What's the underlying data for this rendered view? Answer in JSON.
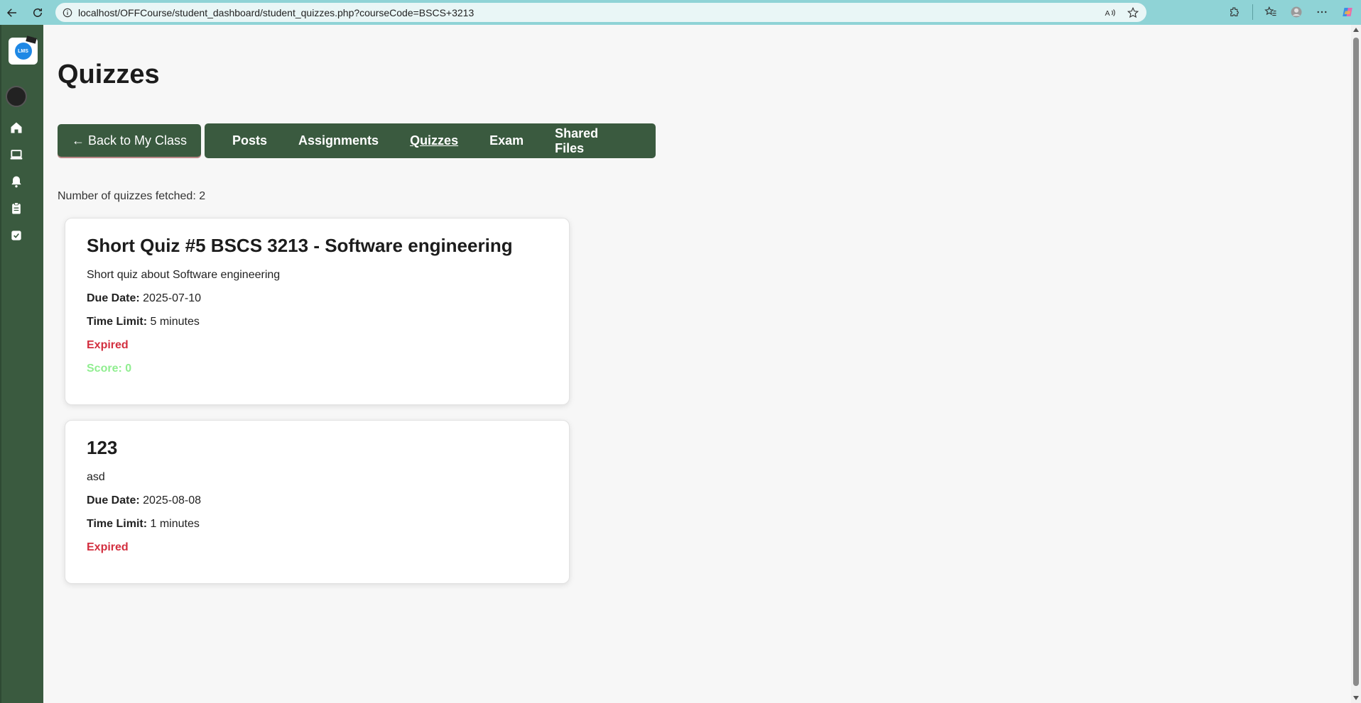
{
  "browser": {
    "url": "localhost/OFFCourse/student_dashboard/student_quizzes.php?courseCode=BSCS+3213"
  },
  "sidebar": {
    "logo_text": "LMS",
    "items": [
      {
        "icon": "home-icon"
      },
      {
        "icon": "laptop-icon"
      },
      {
        "icon": "bell-icon"
      },
      {
        "icon": "clipboard-icon"
      },
      {
        "icon": "checkbox-icon"
      }
    ]
  },
  "main": {
    "title": "Quizzes",
    "back_button": "← Back to My Class",
    "tabs": [
      {
        "label": "Posts"
      },
      {
        "label": "Assignments"
      },
      {
        "label": "Quizzes"
      },
      {
        "label": "Exam"
      },
      {
        "label": "Shared Files"
      }
    ],
    "count_text": "Number of quizzes fetched: 2",
    "quizzes": [
      {
        "title": "Short Quiz #5 BSCS 3213 - Software engineering",
        "description": "Short quiz about Software engineering",
        "due_label": "Due Date:",
        "due_value": "2025-07-10",
        "time_label": "Time Limit:",
        "time_value": "5 minutes",
        "status": "Expired",
        "score": "Score: 0"
      },
      {
        "title": "123",
        "description": "asd",
        "due_label": "Due Date:",
        "due_value": "2025-08-08",
        "time_label": "Time Limit:",
        "time_value": "1 minutes",
        "status": "Expired"
      }
    ]
  },
  "colors": {
    "sidebar": "#3a5a3f",
    "expired": "#d32f3f",
    "score": "#90ee90",
    "browser_bar": "#8fd3d6"
  }
}
